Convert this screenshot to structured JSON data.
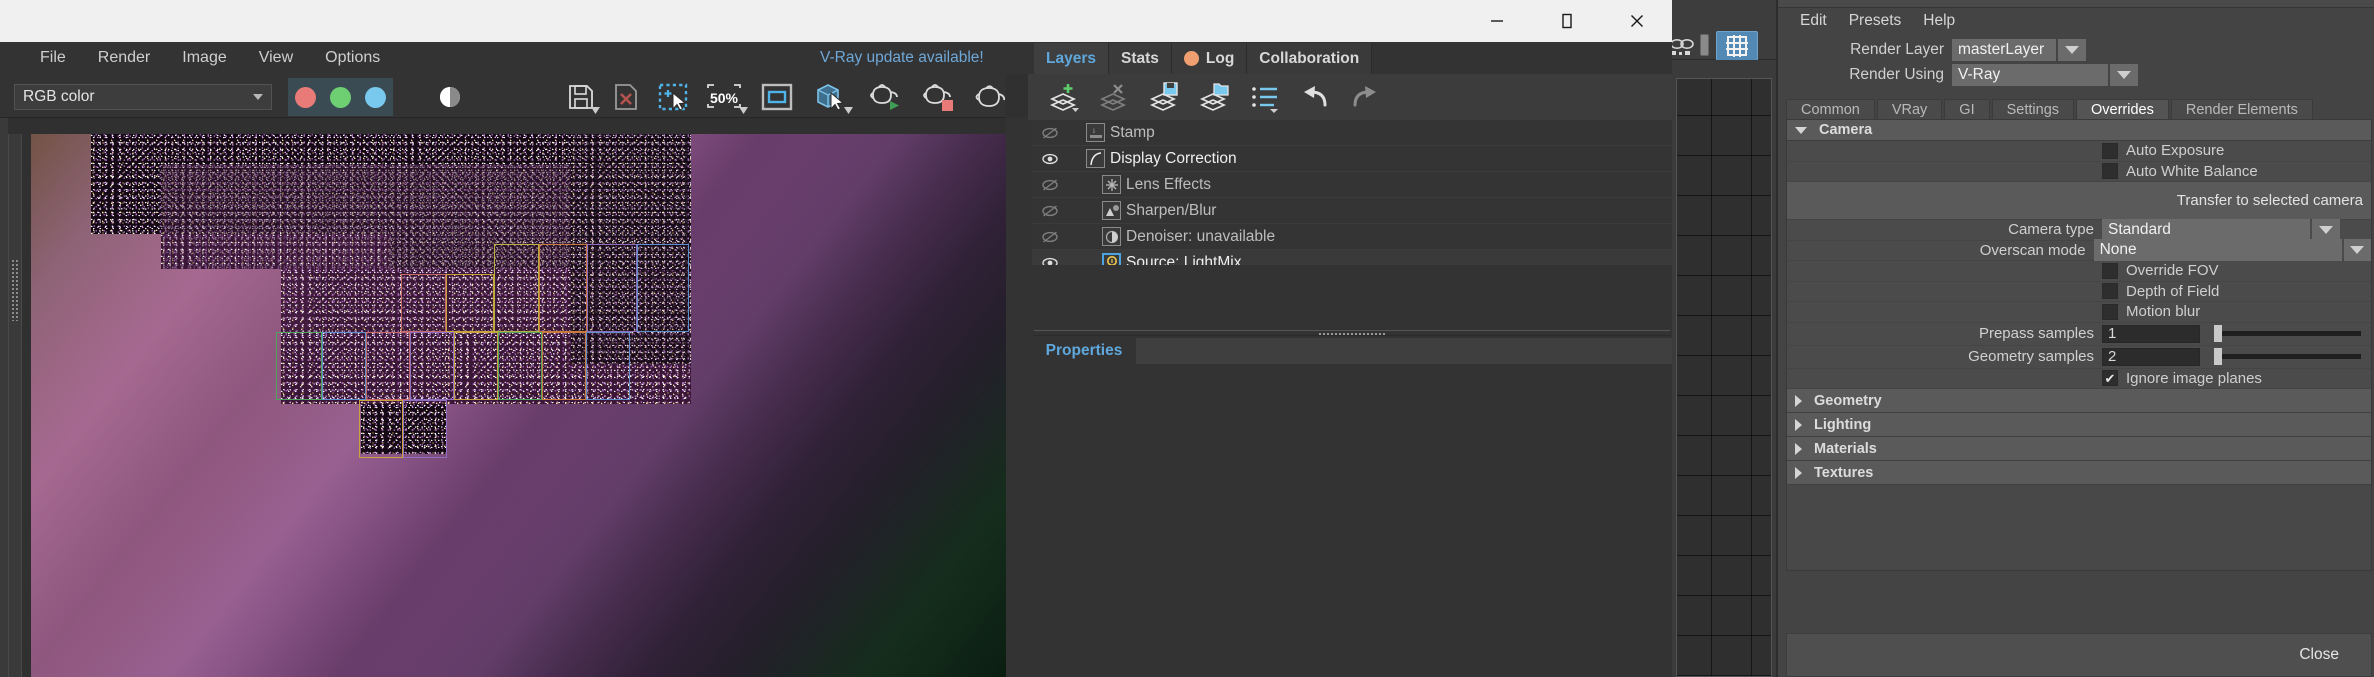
{
  "window": {
    "controls": {
      "minimize": "—",
      "maximize": "☐",
      "close": "✕"
    }
  },
  "vfb": {
    "menu": [
      "File",
      "Render",
      "Image",
      "View",
      "Options"
    ],
    "update_notice": "V-Ray update available!",
    "channel_select": {
      "value": "RGB color"
    },
    "zoom_level": "50%",
    "toolbar_icons": [
      "red-channel-icon",
      "green-channel-icon",
      "blue-channel-icon",
      "alpha-channel-icon",
      "save-image-icon",
      "clear-image-icon",
      "region-render-icon",
      "zoom-level-icon",
      "fit-to-window-icon",
      "pick-object-icon",
      "start-render-icon",
      "stop-render-icon",
      "render-last-icon"
    ]
  },
  "layers_dock": {
    "tabs": [
      {
        "label": "Layers",
        "active": true,
        "icon": null
      },
      {
        "label": "Stats",
        "active": false,
        "icon": null
      },
      {
        "label": "Log",
        "active": false,
        "icon": "log-status-dot"
      },
      {
        "label": "Collaboration",
        "active": false,
        "icon": null
      }
    ],
    "toolbar": [
      "add-layer-icon",
      "delete-layer-icon",
      "save-layers-icon",
      "load-layers-icon",
      "layer-presets-icon",
      "undo-icon",
      "redo-icon"
    ],
    "layers": [
      {
        "name": "Stamp",
        "visible": false,
        "indent": 1,
        "icon": "stamp-icon",
        "selected": false
      },
      {
        "name": "Display Correction",
        "visible": true,
        "indent": 1,
        "icon": "curve-icon",
        "selected": false
      },
      {
        "name": "Lens Effects",
        "visible": false,
        "indent": 2,
        "icon": "lens-flare-icon",
        "selected": false
      },
      {
        "name": "Sharpen/Blur",
        "visible": false,
        "indent": 2,
        "icon": "sharpen-blur-icon",
        "selected": false
      },
      {
        "name": "Denoiser: unavailable",
        "visible": false,
        "indent": 2,
        "icon": "denoiser-icon",
        "selected": false
      },
      {
        "name": "Source: LightMix",
        "visible": true,
        "indent": 2,
        "icon": "lightmix-icon",
        "selected": true
      }
    ],
    "properties": {
      "title": "Properties"
    }
  },
  "render_settings": {
    "menu": [
      "Edit",
      "Presets",
      "Help"
    ],
    "render_layer": {
      "label": "Render Layer",
      "value": "masterLayer"
    },
    "render_using": {
      "label": "Render Using",
      "value": "V-Ray"
    },
    "tabs": [
      {
        "label": "Common",
        "active": false
      },
      {
        "label": "VRay",
        "active": false
      },
      {
        "label": "GI",
        "active": false
      },
      {
        "label": "Settings",
        "active": false
      },
      {
        "label": "Overrides",
        "active": true
      },
      {
        "label": "Render Elements",
        "active": false
      }
    ],
    "camera_section": {
      "title": "Camera",
      "expanded": true,
      "auto_exposure": {
        "label": "Auto Exposure",
        "checked": false
      },
      "auto_white_balance": {
        "label": "Auto White Balance",
        "checked": false
      },
      "transfer_button": "Transfer to selected camera",
      "camera_type": {
        "label": "Camera type",
        "value": "Standard"
      },
      "overscan_mode": {
        "label": "Overscan mode",
        "value": "None"
      },
      "override_fov": {
        "label": "Override FOV",
        "checked": false
      },
      "depth_of_field": {
        "label": "Depth of Field",
        "checked": false
      },
      "motion_blur": {
        "label": "Motion blur",
        "checked": false
      },
      "prepass_samples": {
        "label": "Prepass samples",
        "value": "1"
      },
      "geometry_samples": {
        "label": "Geometry samples",
        "value": "2"
      },
      "ignore_image_planes": {
        "label": "Ignore image planes",
        "checked": true
      }
    },
    "collapsed_sections": [
      "Geometry",
      "Lighting",
      "Materials",
      "Textures"
    ],
    "footer": {
      "close_label": "Close"
    }
  },
  "maya": {
    "grid_snap_icon": "grid-snap-icon",
    "chain_icon": "construction-history-icon"
  },
  "colors": {
    "accent_blue": "#5fa8dd",
    "link_blue": "#6ea8d8",
    "panel_bg": "#333333",
    "settings_bg": "#444444",
    "red_channel": "#e87b78",
    "green_channel": "#6ecf72",
    "blue_channel": "#79c8ee",
    "log_dot": "#f0a070",
    "select_highlight": "#4da3e0"
  }
}
